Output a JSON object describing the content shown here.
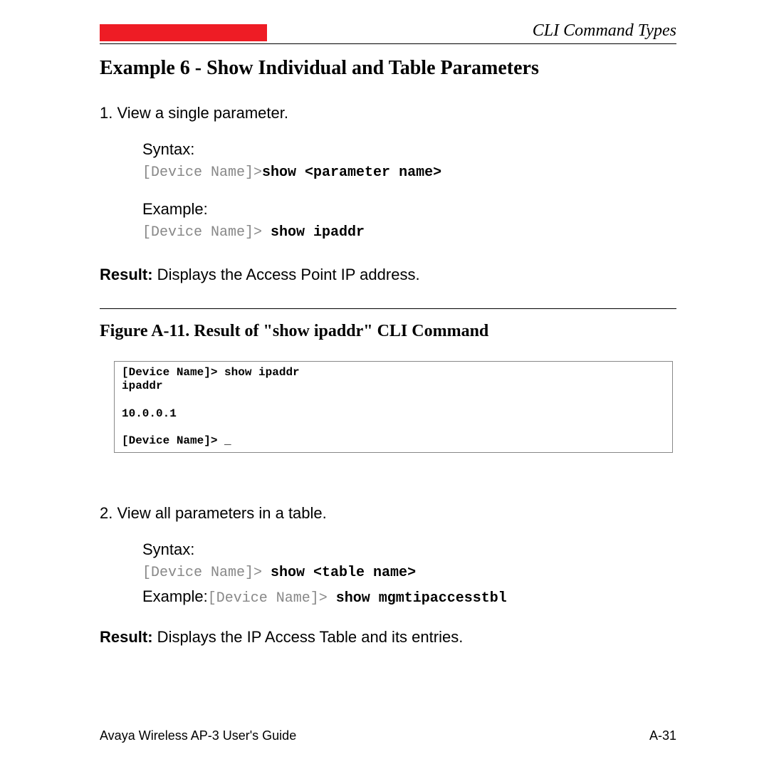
{
  "header": {
    "section_title": "CLI Command Types"
  },
  "heading": "Example 6 - Show Individual and Table Parameters",
  "item1": {
    "text": "1. View a single parameter.",
    "syntax_label": "Syntax:",
    "syntax_prefix": "[Device Name]>",
    "syntax_bold": "show <parameter name>",
    "example_label": "Example:",
    "example_prefix": "[Device Name]> ",
    "example_bold": "show ipaddr",
    "result_label": "Result:",
    "result_text": " Displays the Access Point IP address."
  },
  "figure": {
    "caption": "Figure A-11.    Result of \"show ipaddr\" CLI Command",
    "cli_lines": "[Device Name]> show ipaddr\nipaddr\n\n10.0.0.1\n\n[Device Name]> _"
  },
  "item2": {
    "text": "2. View all parameters in a table.",
    "syntax_label": "Syntax:",
    "syntax_prefix": "[Device Name]> ",
    "syntax_bold": "show <table name>",
    "example_label": "Example:",
    "example_prefix": "[Device Name]> ",
    "example_bold": "show mgmtipaccesstbl",
    "result_label": "Result:",
    "result_text": " Displays the IP Access Table and its entries."
  },
  "footer": {
    "left": "Avaya Wireless AP-3 User's Guide",
    "right": "A-31"
  }
}
